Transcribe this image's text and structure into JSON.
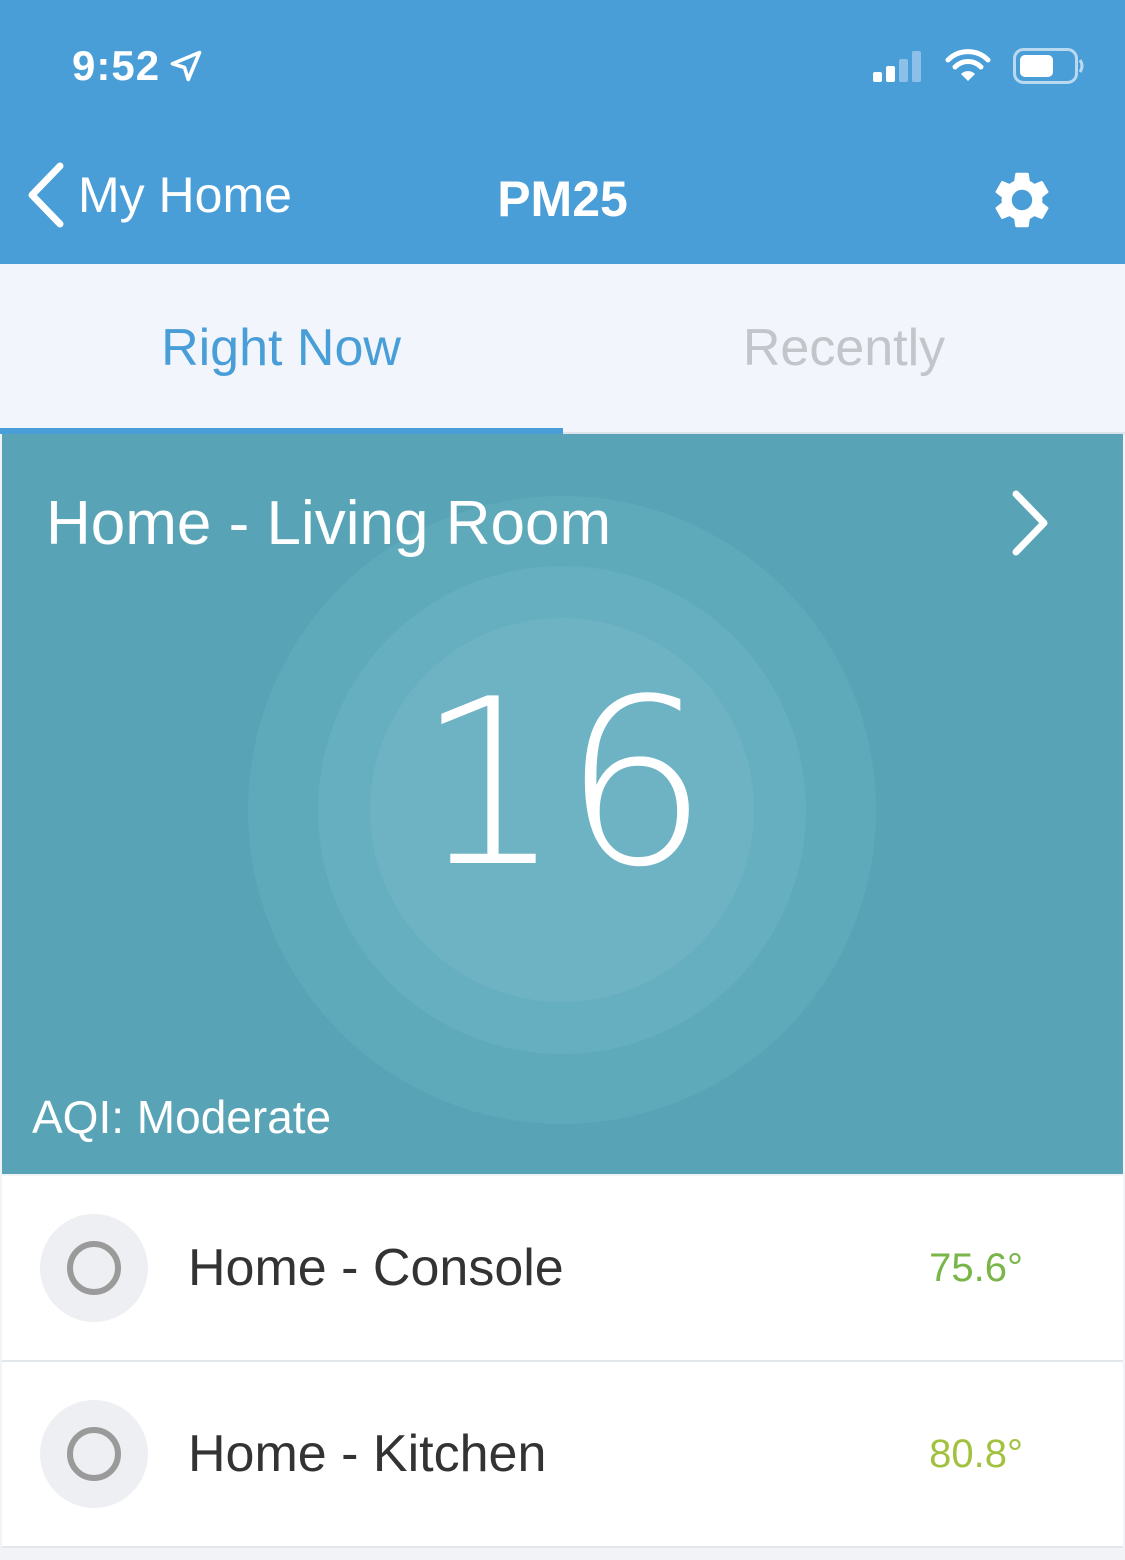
{
  "status_bar": {
    "time": "9:52"
  },
  "nav": {
    "back_label": "My Home",
    "title": "PM25"
  },
  "tabs": [
    {
      "label": "Right Now",
      "active": true
    },
    {
      "label": "Recently",
      "active": false
    }
  ],
  "hero": {
    "location": "Home - Living Room",
    "value": "16",
    "aqi": "AQI: Moderate",
    "background": "#58a4b6"
  },
  "sensors": [
    {
      "name": "Home - Console",
      "temp": "75.6°",
      "temp_color": "#79b548"
    },
    {
      "name": "Home - Kitchen",
      "temp": "80.8°",
      "temp_color": "#a2c23f"
    }
  ],
  "colors": {
    "accent": "#4a9ed7",
    "inactive_tab": "#c2c5ca"
  }
}
